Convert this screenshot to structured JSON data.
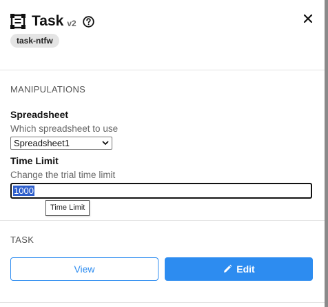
{
  "header": {
    "title": "Task",
    "version": "v2",
    "icon": "task-frame-icon",
    "help_icon": "help-circle-icon",
    "close_icon": "close-icon"
  },
  "badge": {
    "label": "task-ntfw"
  },
  "manipulations": {
    "section_title": "MANIPULATIONS",
    "spreadsheet": {
      "label": "Spreadsheet",
      "description": "Which spreadsheet to use",
      "selected": "Spreadsheet1"
    },
    "time_limit": {
      "label": "Time Limit",
      "description": "Change the trial time limit",
      "value": "1000",
      "tooltip": "Time Limit"
    }
  },
  "task_section": {
    "section_title": "TASK",
    "view_label": "View",
    "edit_label": "Edit",
    "edit_icon": "pencil-icon"
  },
  "colors": {
    "accent": "#2d8cf0",
    "selection": "#2f5fcb",
    "badge_bg": "#e4e4e4"
  }
}
